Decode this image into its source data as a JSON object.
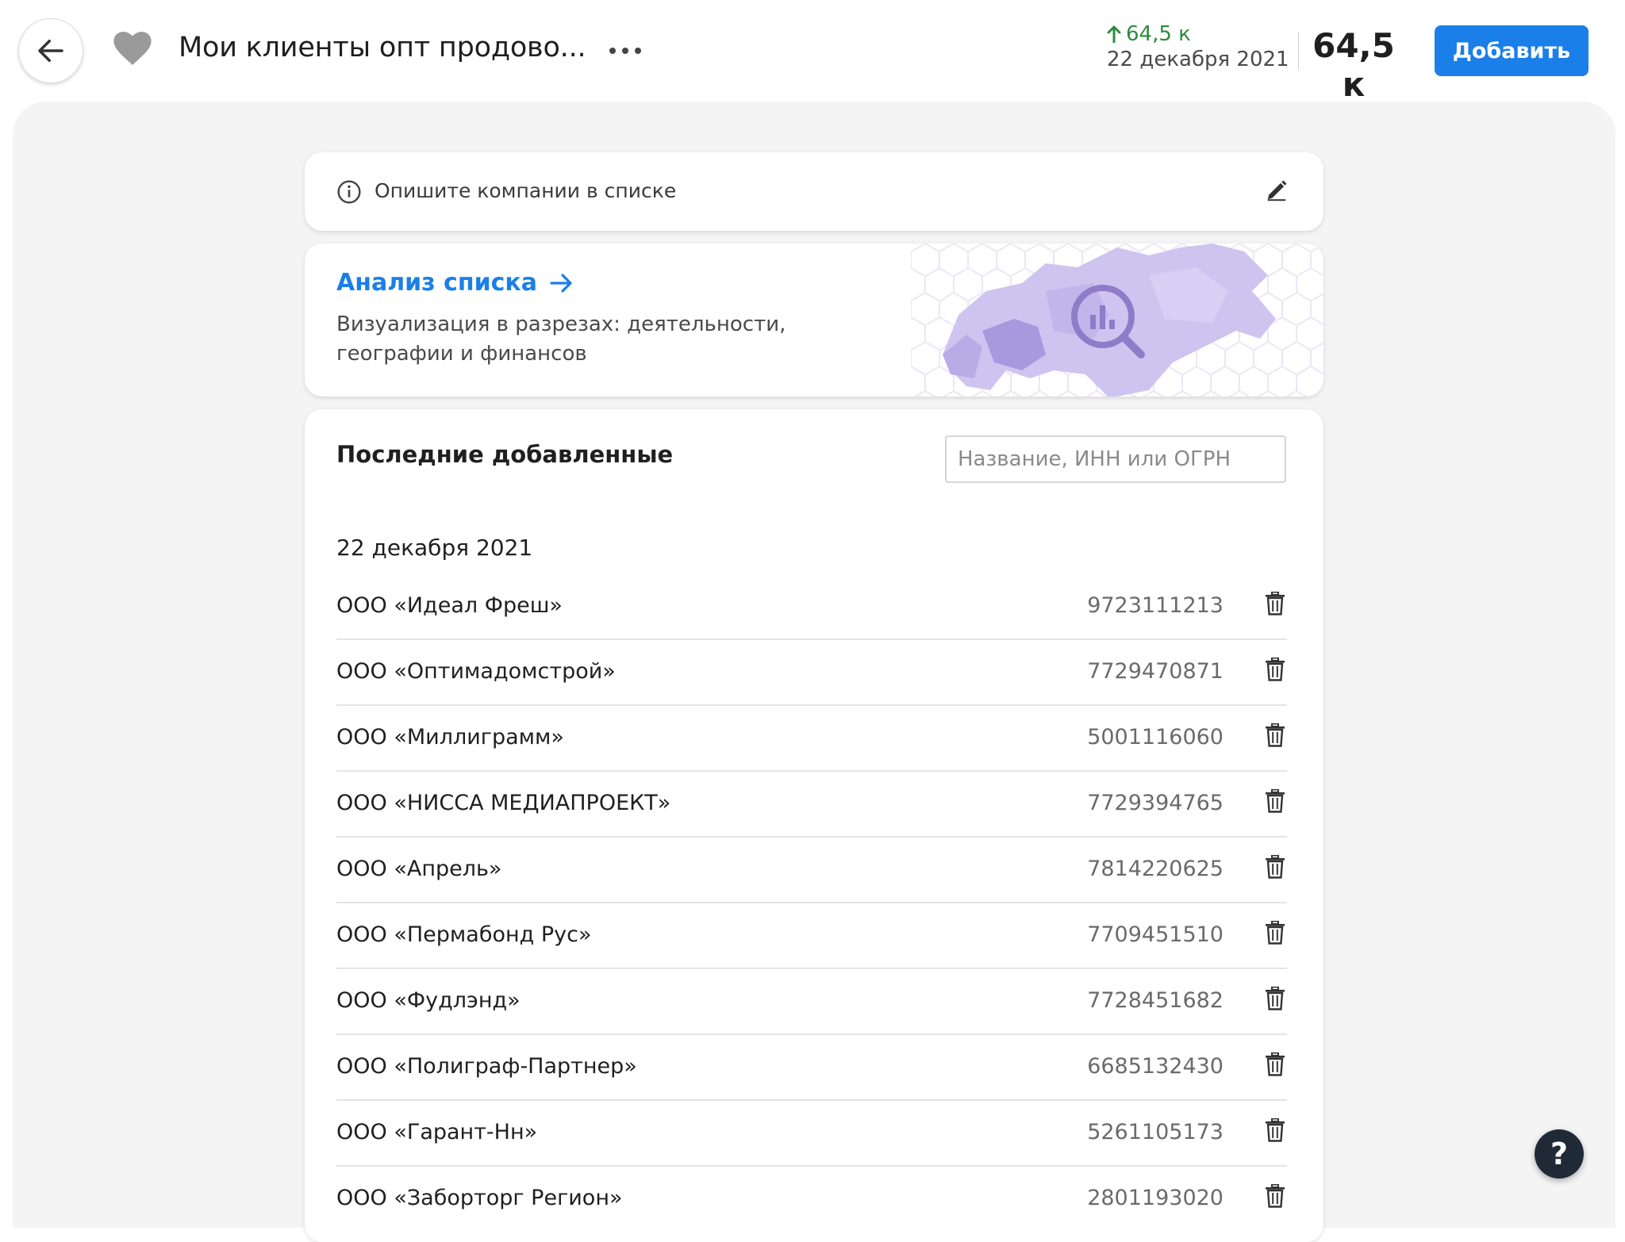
{
  "header": {
    "title": "Мои клиенты опт продово...",
    "delta": "64,5 к",
    "date": "22 декабря 2021",
    "total": "64,5 к",
    "add_label": "Добавить"
  },
  "description": {
    "placeholder_text": "Опишите компании в списке"
  },
  "analysis": {
    "link_label": "Анализ списка",
    "subtitle": "Визуализация в разрезах: деятельности, географии и финансов"
  },
  "list": {
    "heading": "Последние добавленные",
    "search_placeholder": "Название, ИНН или ОГРН",
    "group_date": "22 декабря 2021",
    "rows": [
      {
        "name": "ООО «Идеал Фреш»",
        "inn": "9723111213"
      },
      {
        "name": "ООО «Оптимадомстрой»",
        "inn": "7729470871"
      },
      {
        "name": "ООО «Миллиграмм»",
        "inn": "5001116060"
      },
      {
        "name": "ООО «НИССА МЕДИАПРОЕКТ»",
        "inn": "7729394765"
      },
      {
        "name": "ООО «Апрель»",
        "inn": "7814220625"
      },
      {
        "name": "ООО «Пермабонд Рус»",
        "inn": "7709451510"
      },
      {
        "name": "ООО «Фудлэнд»",
        "inn": "7728451682"
      },
      {
        "name": "ООО «Полиграф-Партнер»",
        "inn": "6685132430"
      },
      {
        "name": "ООО «Гарант-Нн»",
        "inn": "5261105173"
      },
      {
        "name": "ООО «Заборторг Регион»",
        "inn": "2801193020"
      }
    ]
  },
  "help": {
    "label": "?"
  },
  "colors": {
    "accent": "#1a7fe8",
    "positive": "#2e8b3e",
    "map": "#b6a8e6"
  },
  "icons": [
    "back-arrow-icon",
    "heart-icon",
    "more-dots-icon",
    "arrow-up-icon",
    "info-icon",
    "pencil-icon",
    "arrow-right-icon",
    "trash-icon",
    "map-analytics-icon"
  ]
}
